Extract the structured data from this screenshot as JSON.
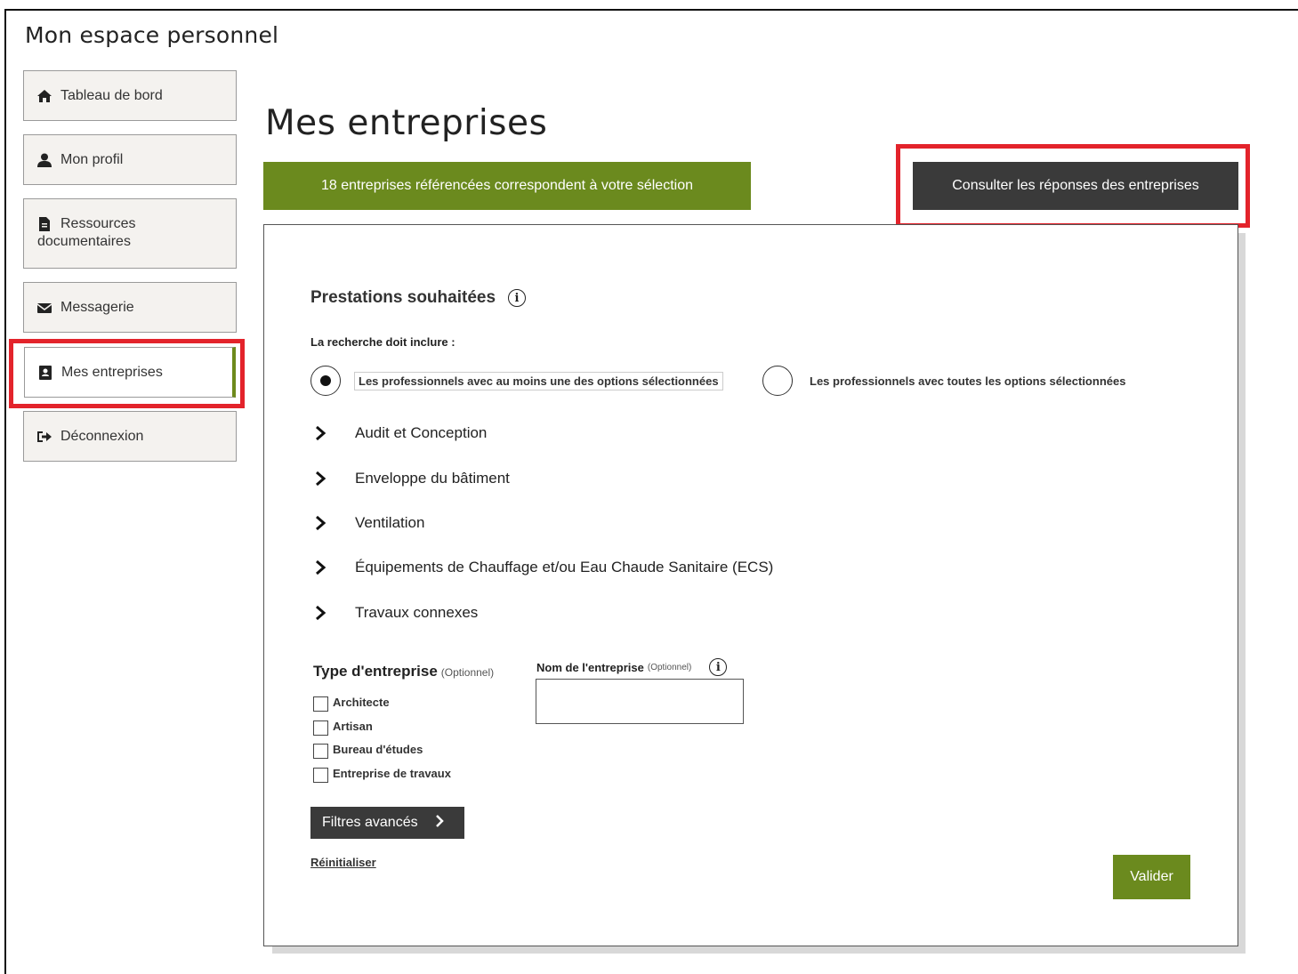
{
  "app": {
    "title": "Mon espace personnel"
  },
  "sidebar": {
    "items": [
      {
        "label": "Tableau de bord",
        "icon": "home-icon"
      },
      {
        "label": "Mon profil",
        "icon": "user-icon"
      },
      {
        "label": "Ressources",
        "label2": "documentaires",
        "icon": "document-icon"
      },
      {
        "label": "Messagerie",
        "icon": "envelope-icon"
      },
      {
        "label": "Mes entreprises",
        "icon": "address-book-icon",
        "active": true
      },
      {
        "label": "Déconnexion",
        "icon": "sign-out-icon"
      }
    ]
  },
  "main": {
    "title": "Mes entreprises",
    "result_banner": "18 entreprises référencées correspondent à votre sélection",
    "consult_button": "Consulter les réponses des entreprises"
  },
  "filters": {
    "services_title": "Prestations souhaitées",
    "search_label": "La recherche doit inclure :",
    "radio_options": [
      {
        "label": "Les professionnels avec au moins une des options sélectionnées",
        "checked": true
      },
      {
        "label": "Les professionnels avec toutes les options sélectionnées",
        "checked": false
      }
    ],
    "categories": [
      "Audit et Conception",
      "Enveloppe du bâtiment",
      "Ventilation",
      "Équipements de Chauffage et/ou Eau Chaude Sanitaire (ECS)",
      "Travaux connexes"
    ],
    "company_type": {
      "title": "Type d'entreprise",
      "optional": "(Optionnel)",
      "options": [
        "Architecte",
        "Artisan",
        "Bureau d'études",
        "Entreprise de travaux"
      ]
    },
    "company_name": {
      "label": "Nom de l'entreprise",
      "optional": "(Optionnel)",
      "value": ""
    },
    "advanced_filters": "Filtres avancés",
    "reset": "Réinitialiser",
    "submit": "Valider"
  },
  "colors": {
    "accent_green": "#6b8a1e",
    "dark_button": "#3a3a3a",
    "highlight_red": "#e3232b"
  }
}
